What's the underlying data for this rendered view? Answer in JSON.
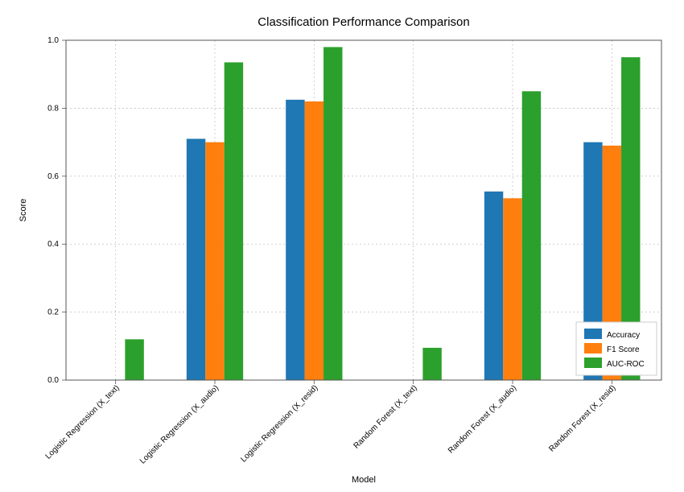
{
  "chart_data": {
    "type": "bar",
    "title": "Classification Performance Comparison",
    "xlabel": "Model",
    "ylabel": "Score",
    "categories": [
      "Logistic Regression (X_text)",
      "Logistic Regression (X_audio)",
      "Logistic Regression (X_resid)",
      "Random Forest (X_text)",
      "Random Forest (X_audio)",
      "Random Forest (X_resid)"
    ],
    "series": [
      {
        "name": "Accuracy",
        "color": "#1f77b4",
        "values": [
          0.0,
          0.71,
          0.825,
          0.0,
          0.555,
          0.7
        ]
      },
      {
        "name": "F1 Score",
        "color": "#ff7f0e",
        "values": [
          0.0,
          0.7,
          0.82,
          0.0,
          0.535,
          0.69
        ]
      },
      {
        "name": "AUC-ROC",
        "color": "#2ca02c",
        "values": [
          0.12,
          0.935,
          0.98,
          0.095,
          0.85,
          0.95
        ]
      }
    ],
    "ylim": [
      0.0,
      1.0
    ],
    "yticks": [
      0.0,
      0.2,
      0.4,
      0.6,
      0.8,
      1.0
    ],
    "legend_position": "lower right"
  }
}
